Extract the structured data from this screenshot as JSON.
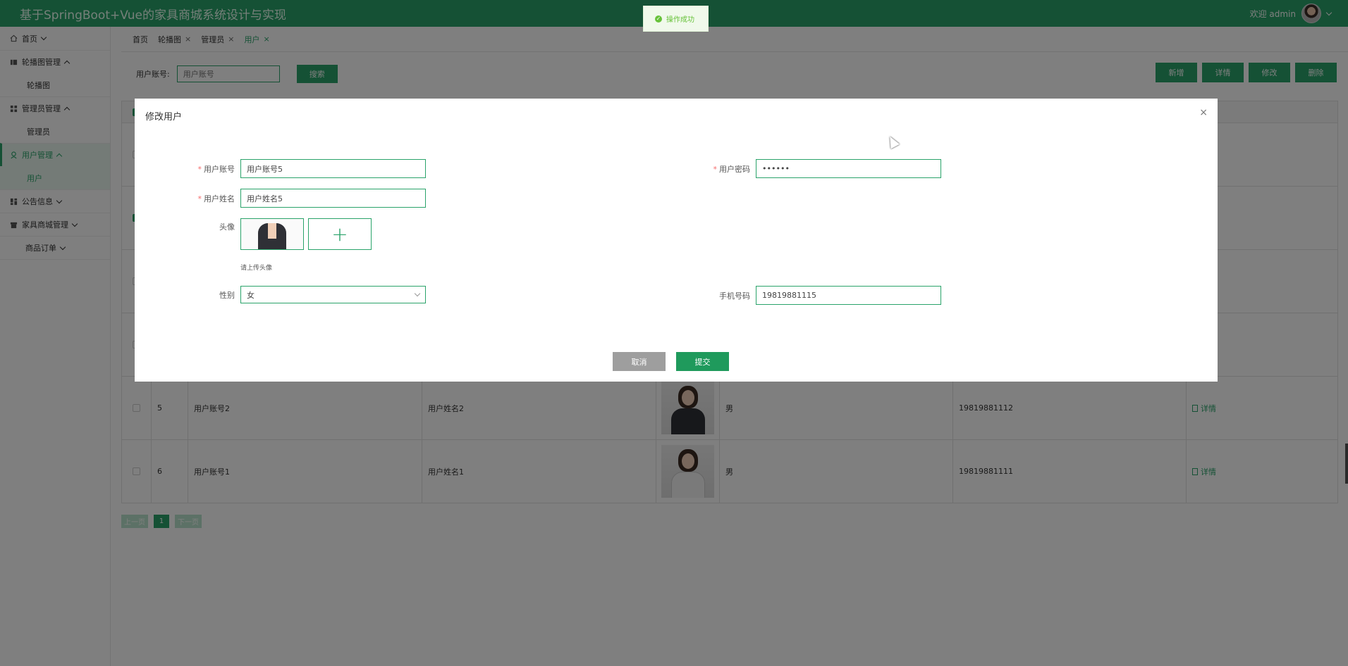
{
  "app": {
    "title": "基于SpringBoot+Vue的家具商城系统设计与实现",
    "welcome": "欢迎 admin"
  },
  "sidebar": {
    "items": [
      {
        "label": "首页"
      },
      {
        "label": "轮播图管理"
      },
      {
        "label": "轮播图"
      },
      {
        "label": "管理员管理"
      },
      {
        "label": "管理员"
      },
      {
        "label": "用户管理"
      },
      {
        "label": "用户"
      },
      {
        "label": "公告信息"
      },
      {
        "label": "家具商城管理"
      },
      {
        "label": "商品订单"
      }
    ]
  },
  "tabs": [
    {
      "label": "首页",
      "close": ""
    },
    {
      "label": "轮播图",
      "close": "×"
    },
    {
      "label": "管理员",
      "close": "×"
    },
    {
      "label": "用户",
      "close": "×"
    }
  ],
  "search": {
    "label": "用户账号:",
    "placeholder": "用户账号",
    "button": "搜索"
  },
  "toolbar": {
    "add": "新增",
    "detail": "详情",
    "edit": "修改",
    "delete": "删除"
  },
  "table": {
    "rows": [
      {
        "index": "5",
        "account": "用户账号2",
        "name": "用户姓名2",
        "gender": "男",
        "phone": "19819881112",
        "action": "详情"
      },
      {
        "index": "6",
        "account": "用户账号1",
        "name": "用户姓名1",
        "gender": "男",
        "phone": "19819881111",
        "action": "详情"
      }
    ]
  },
  "pager": {
    "prev": "上一页",
    "current": "1",
    "next": "下一页"
  },
  "toast": {
    "text": "操作成功"
  },
  "modal": {
    "title": "修改用户",
    "close": "×",
    "fields": {
      "account": {
        "label": "用户账号",
        "value": "用户账号5"
      },
      "password": {
        "label": "用户密码",
        "value": "••••••"
      },
      "name": {
        "label": "用户姓名",
        "value": "用户姓名5"
      },
      "avatar": {
        "label": "头像",
        "hint": "请上传头像",
        "add": "+"
      },
      "gender": {
        "label": "性别",
        "value": "女"
      },
      "phone": {
        "label": "手机号码",
        "value": "19819881115"
      }
    },
    "cancel": "取消",
    "submit": "提交"
  }
}
